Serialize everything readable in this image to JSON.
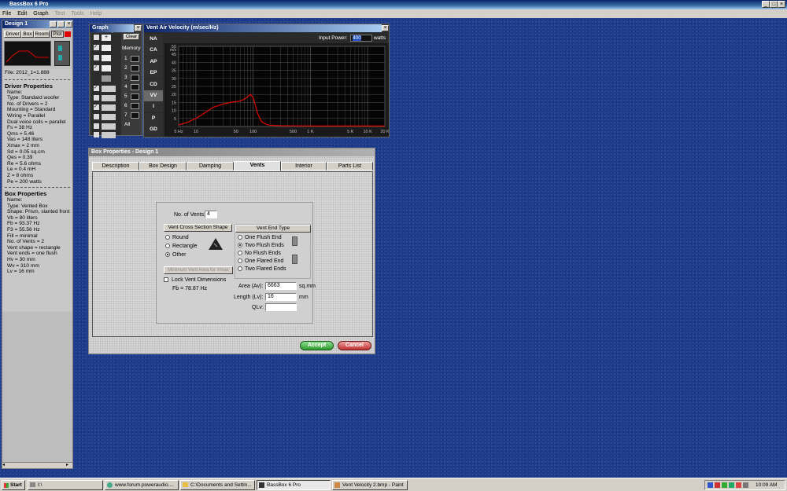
{
  "app": {
    "title": "BassBox 6 Pro",
    "menu": [
      "File",
      "Edit",
      "Graph",
      "Test",
      "Tools",
      "Help"
    ]
  },
  "design": {
    "title": "Design 1",
    "buttons": [
      "Driver",
      "Box",
      "Room",
      "Plot"
    ],
    "file": "File: 2012_1=1.888",
    "driver_header": "Driver Properties",
    "driver_lines": [
      "Name:",
      "Type: Standard woofer",
      "No. of Drivers = 2",
      "Mounting = Standard",
      "Wiring = Parallel",
      "Dual voice coils = parallel",
      "Fs = 38 Hz",
      "Qms = 5.46",
      "Vas = 148 liters",
      "Xmax = 2 mm",
      "Sd = 0.05 sq.cm",
      "Qes = 0.39",
      "Re = 5.6 ohms",
      "Le = 0.4 mH",
      "Z = 8 ohms",
      "Pe = 200 watts"
    ],
    "box_header": "Box Properties",
    "box_lines": [
      "Name:",
      "Type: Vented Box",
      "Shape: Prism, slanted front",
      "Vb = 80 liters",
      "Fb = 93.37 Hz",
      "F3 = 55.56 Hz",
      "Fill = minimal",
      "No. of Vents = 2",
      "Vent shape = rectangle",
      "Vent ends = one flush",
      "Hv = 30 mm",
      "Wv = 310 mm",
      "Lv = 16 mm"
    ]
  },
  "graph_props": {
    "title": "Graph Properties",
    "clear": "Clear",
    "memory": "Memory",
    "memory_slots": [
      "1",
      "2",
      "3",
      "4",
      "5",
      "6",
      "7",
      "All"
    ]
  },
  "plot": {
    "title": "Vent Air Velocity (m/sec/Hz)",
    "input_power_label": "Input Power:",
    "input_power_value": "400",
    "input_power_unit": "watts",
    "side_tabs": [
      "NA",
      "CA",
      "AP",
      "EP",
      "CD",
      "VV",
      "I",
      "P",
      "GD"
    ],
    "y_unit": "m/s",
    "y_ticks": [
      "50",
      "45",
      "40",
      "35",
      "30",
      "25",
      "20",
      "15",
      "10",
      "5"
    ],
    "x_ticks": [
      "5 Hz",
      "10",
      "50",
      "100",
      "500",
      "1 K",
      "5 K",
      "10 K",
      "20 K"
    ]
  },
  "chart_data": {
    "type": "line",
    "title": "Vent Air Velocity (m/sec/Hz)",
    "xscale": "log",
    "xlim": [
      5,
      20000
    ],
    "ylim": [
      0,
      50
    ],
    "ylabel": "m/s",
    "grid": true,
    "series": [
      {
        "color": "#e00000",
        "x": [
          5,
          7,
          10,
          15,
          20,
          30,
          40,
          50,
          60,
          70,
          80,
          90,
          100,
          110,
          120,
          140,
          170,
          200,
          300,
          500,
          1000,
          5000,
          20000
        ],
        "y": [
          1,
          2.5,
          5,
          9,
          12,
          14,
          15,
          15.5,
          16,
          17,
          18.5,
          20,
          18,
          13,
          8,
          3,
          1.3,
          0.8,
          0.5,
          0.4,
          0.3,
          0.3,
          0.3
        ]
      }
    ]
  },
  "box_dialog": {
    "title": "Box Properties - Design 1",
    "tabs": [
      "Description",
      "Box Design",
      "Damping",
      "Vents",
      "Interior",
      "Parts List"
    ],
    "vents_label": "No. of Vents:",
    "vents_value": "4",
    "cross_section_title": "Vent Cross Section Shape",
    "shapes": [
      "Round",
      "Rectangle",
      "Other"
    ],
    "min_vent_button": "Minimum Vent Area for Xmax",
    "lock_label": "Lock Vent Dimensions",
    "fb": "Fb = 78.87 Hz",
    "vent_end_title": "Vent End Type",
    "end_types": [
      "One Flush End",
      "Two Flush Ends",
      "No Flush Ends",
      "One Flared End",
      "Two Flared Ends"
    ],
    "area_label": "Area (Av):",
    "area_value": "6663",
    "area_unit": "sq.mm",
    "length_label": "Length (Lv):",
    "length_value": "16",
    "length_unit": "mm",
    "qlv_label": "QLv:",
    "qlv_value": "",
    "accept": "Accept",
    "cancel": "Cancel"
  },
  "taskbar": {
    "start": "Start",
    "items": [
      "I:\\",
      "www.forum.poweraudio....",
      "C:\\Documents and Settin...",
      "BassBox 6 Pro",
      "Vent Velocity 2.bmp - Paint"
    ],
    "clock": "10:09 AM"
  }
}
